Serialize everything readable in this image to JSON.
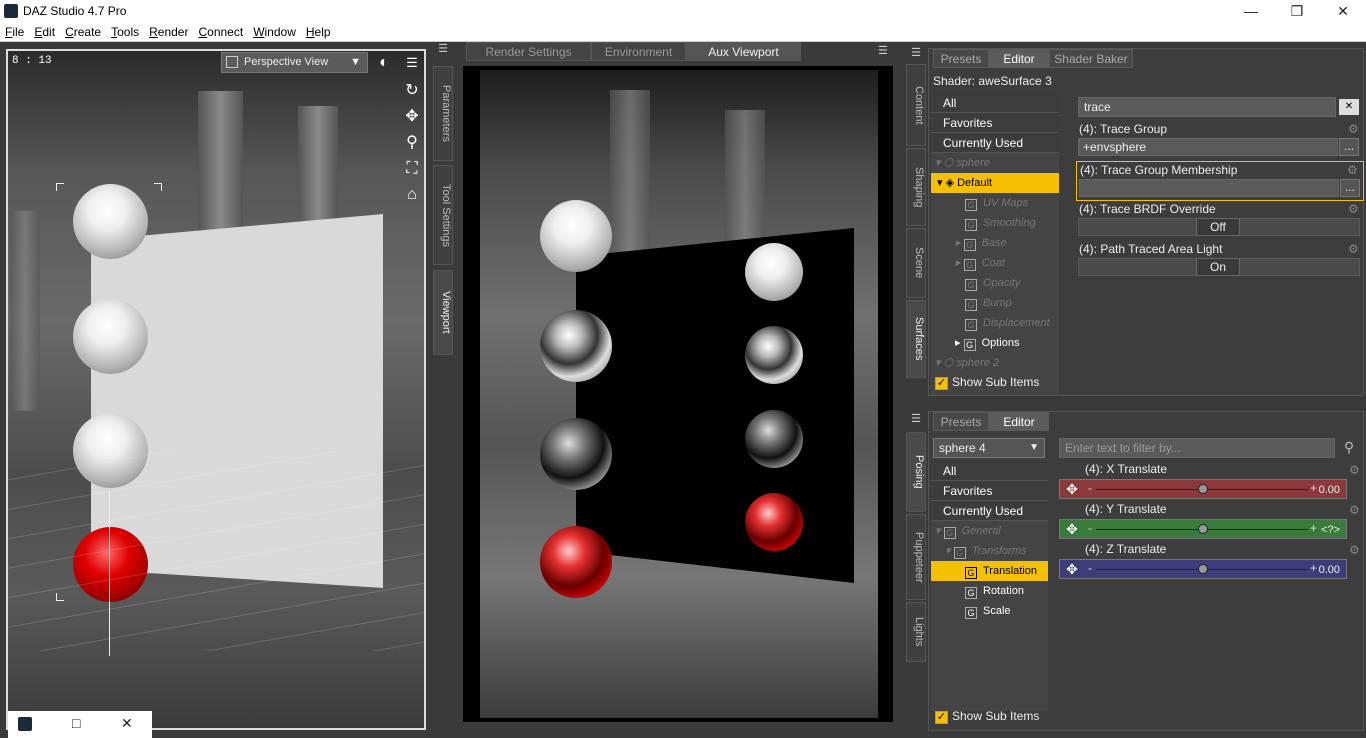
{
  "window": {
    "title": "DAZ Studio 4.7 Pro",
    "min": "—",
    "max": "❐",
    "close": "✕"
  },
  "menu": [
    "File",
    "Edit",
    "Create",
    "Tools",
    "Render",
    "Connect",
    "Window",
    "Help"
  ],
  "viewport": {
    "clock": "8 : 13",
    "view_select": "Perspective View"
  },
  "left_side_tabs": [
    "Parameters",
    "Tool Settings",
    "Viewport"
  ],
  "render_tabs": [
    "Render Settings",
    "Environment",
    "Aux Viewport"
  ],
  "right_side_tabs_top": [
    "Content",
    "Shaping",
    "Scene",
    "Surfaces"
  ],
  "right_side_tabs_bottom": [
    "Posing",
    "Puppeteer",
    "Lights"
  ],
  "surfaces": {
    "tabs": [
      "Presets",
      "Editor",
      "Shader Baker"
    ],
    "shader_label": "Shader: aweSurface 3",
    "filters": [
      "All",
      "Favorites",
      "Currently Used"
    ],
    "tree": [
      {
        "label": "sphere",
        "state": "dim"
      },
      {
        "label": "Default",
        "state": "selected"
      },
      {
        "label": "UV Maps",
        "state": "dim"
      },
      {
        "label": "Smoothing",
        "state": "dim"
      },
      {
        "label": "Base",
        "state": "dim"
      },
      {
        "label": "Coat",
        "state": "dim"
      },
      {
        "label": "Opacity",
        "state": "dim"
      },
      {
        "label": "Bump",
        "state": "dim"
      },
      {
        "label": "Displacement",
        "state": "dim"
      },
      {
        "label": "Options",
        "state": "normal"
      },
      {
        "label": "sphere 2",
        "state": "dim"
      }
    ],
    "show_sub_items": "Show Sub Items",
    "search_value": "trace",
    "props": [
      {
        "label": "(4): Trace Group",
        "value": "+envsphere"
      },
      {
        "label": "(4): Trace Group Membership",
        "value": ""
      },
      {
        "label": "(4): Trace BRDF Override",
        "value": "Off"
      },
      {
        "label": "(4): Path Traced Area Light",
        "value": "On"
      }
    ],
    "dots": "..."
  },
  "posing": {
    "tabs": [
      "Presets",
      "Editor"
    ],
    "node_select": "sphere 4",
    "filters": [
      "All",
      "Favorites",
      "Currently Used"
    ],
    "tree": [
      {
        "label": "General",
        "state": "dim"
      },
      {
        "label": "Transforms",
        "state": "dim"
      },
      {
        "label": "Translation",
        "state": "selected"
      },
      {
        "label": "Rotation",
        "state": "normal"
      },
      {
        "label": "Scale",
        "state": "normal"
      }
    ],
    "show_sub_items": "Show Sub Items",
    "search_placeholder": "Enter text to filter by...",
    "sliders": [
      {
        "label": "(4): X Translate",
        "value": "0.00",
        "color": "#8a3a3a"
      },
      {
        "label": "(4): Y Translate",
        "value": "<?>",
        "color": "#3a7a3a"
      },
      {
        "label": "(4): Z Translate",
        "value": "0.00",
        "color": "#3d3d7a"
      }
    ]
  },
  "taskbar": {
    "restore": "□",
    "close": "✕"
  }
}
